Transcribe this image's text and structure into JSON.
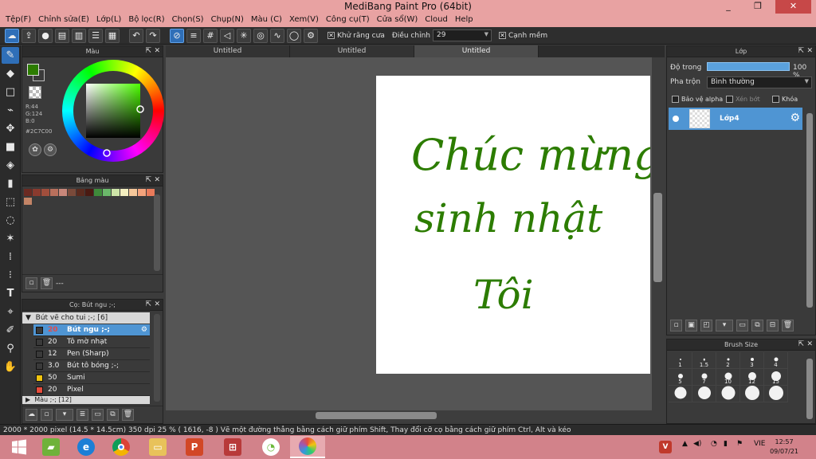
{
  "window": {
    "title": "MediBang Paint Pro (64bit)",
    "minimize_glyph": "_",
    "maximize_glyph": "❐",
    "close_glyph": "✕"
  },
  "menu": [
    "Tệp(F)",
    "Chỉnh sửa(E)",
    "Lớp(L)",
    "Bộ lọc(R)",
    "Chọn(S)",
    "Chụp(N)",
    "Màu (C)",
    "Xem(V)",
    "Công cụ(T)",
    "Cửa sổ(W)",
    "Cloud",
    "Help"
  ],
  "toolbar": {
    "antialias_label": "Khử răng cưa",
    "correction_label": "Điều chỉnh",
    "correction_value": "29",
    "soft_edge_label": "Cạnh mềm"
  },
  "color_panel": {
    "title": "Màu",
    "fg_color": "#2c7c00",
    "r": "R:44",
    "g": "G:124",
    "b": "B:0",
    "hex": "#2C7C00"
  },
  "palette_panel": {
    "title": "Bảng màu",
    "footer_text": "---",
    "colors_row1": [
      "#6b2a22",
      "#8a3a2e",
      "#a14e3c",
      "#b9705c",
      "#c9877a",
      "#7a4a3a",
      "#5a2a1e",
      "#4a1a12",
      "#3f8a3a",
      "#6bb86a",
      "#cde4a8",
      "#f4efc0",
      "#f6c79a",
      "#f4a37c",
      "#e97a5a"
    ],
    "colors_row2": [
      "#c38466"
    ]
  },
  "brush_panel": {
    "title": "Cọ: Bút ngu ;-;",
    "group_open": "Bút vẽ cho tui ;-; [6]",
    "group_closed": "Màu ;-; [12]",
    "items": [
      {
        "size": "20",
        "name": "Bút ngu ;-;",
        "color": "#3a3a3a"
      },
      {
        "size": "20",
        "name": "Tô mờ nhạt",
        "color": "#3a3a3a"
      },
      {
        "size": "12",
        "name": "Pen (Sharp)",
        "color": "#3a3a3a"
      },
      {
        "size": "3.0",
        "name": "Bút tô bóng ;-;",
        "color": "#3a3a3a"
      },
      {
        "size": "50",
        "name": "Sumi",
        "color": "#f1c40f"
      },
      {
        "size": "20",
        "name": "Pixel",
        "color": "#e74c3c"
      }
    ]
  },
  "tabs": [
    "Untitled",
    "Untitled",
    "Untitled"
  ],
  "canvas": {
    "line1": "Chúc mừng",
    "line2": "sinh nhật",
    "line3": "Tôi",
    "ink_color": "#2c7c00"
  },
  "layer_panel": {
    "title": "Lớp",
    "opacity_label": "Độ trong",
    "opacity_value": "100 %",
    "opacity_fraction": 1.0,
    "blend_label": "Pha trộn",
    "blend_value": "Bình thường",
    "protect_alpha_label": "Bảo vệ alpha",
    "clip_label": "Xén bớt",
    "lock_label": "Khóa",
    "layer_name": "Lớp4"
  },
  "brush_size_panel": {
    "title": "Brush Size",
    "sizes": [
      "1",
      "1.5",
      "2",
      "3",
      "4",
      "5",
      "7",
      "10",
      "12",
      "15",
      "",
      "",
      "",
      "",
      ""
    ]
  },
  "status": {
    "text": "2000 * 2000 pixel   (14.5 * 14.5cm)   350 dpi   25 %   ( 1616, -8 )   Vẽ một đường thẳng bằng cách giữ phím Shift, Thay đổi cỡ cọ bằng cách giữ phím Ctrl, Alt và kéo"
  },
  "taskbar": {
    "language": "VIE",
    "time": "12:57",
    "date": "09/07/21"
  }
}
